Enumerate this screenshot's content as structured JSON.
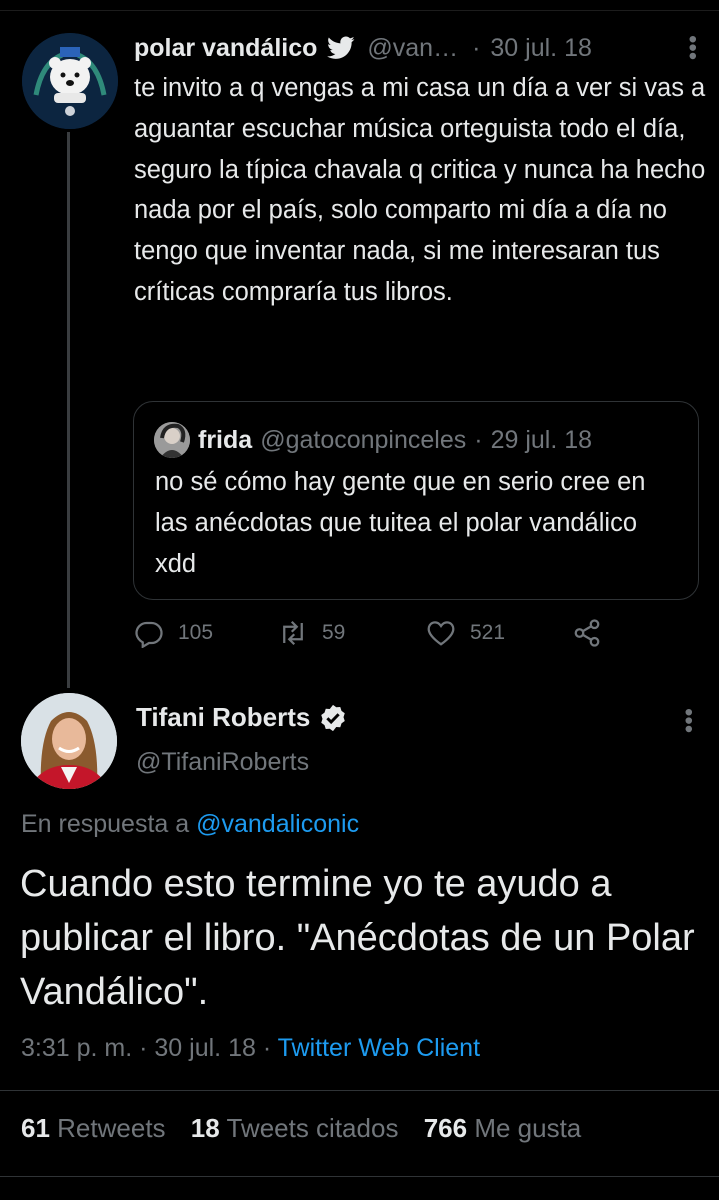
{
  "parent_tweet": {
    "name": "polar vandálico",
    "handle": "@van…",
    "separator": "·",
    "date": "30 jul. 18",
    "text": "te invito a q vengas a mi casa un día a ver si vas a aguantar escuchar música orteguista todo el día, seguro la típica chavala q critica y nunca ha hecho nada por el país, solo comparto mi día a día no tengo que inventar nada, si me interesaran tus críticas compraría tus libros.",
    "quote": {
      "name": "frida",
      "handle": "@gatoconpinceles",
      "separator": "·",
      "date": "29 jul. 18",
      "text": "no sé cómo hay gente que en serio cree en las anécdotas que tuitea el polar vandálico xdd"
    },
    "actions": {
      "replies": "105",
      "retweets": "59",
      "likes": "521"
    }
  },
  "main_tweet": {
    "name": "Tifani Roberts",
    "handle": "@TifaniRoberts",
    "reply_prefix": "En respuesta a",
    "reply_mention": "@vandaliconic",
    "text": "Cuando esto termine yo te ayudo a publicar el libro. \"Anécdotas de un Polar Vandálico\".",
    "time": "3:31 p. m.",
    "separator": "·",
    "date": "30 jul. 18",
    "client": "Twitter Web Client",
    "stats": {
      "retweets_count": "61",
      "retweets_label": "Retweets",
      "quotes_count": "18",
      "quotes_label": "Tweets citados",
      "likes_count": "766",
      "likes_label": "Me gusta"
    }
  },
  "colors": {
    "background": "#000000",
    "text": "#e7e9ea",
    "secondary": "#71767b",
    "link": "#1d9bf0"
  }
}
